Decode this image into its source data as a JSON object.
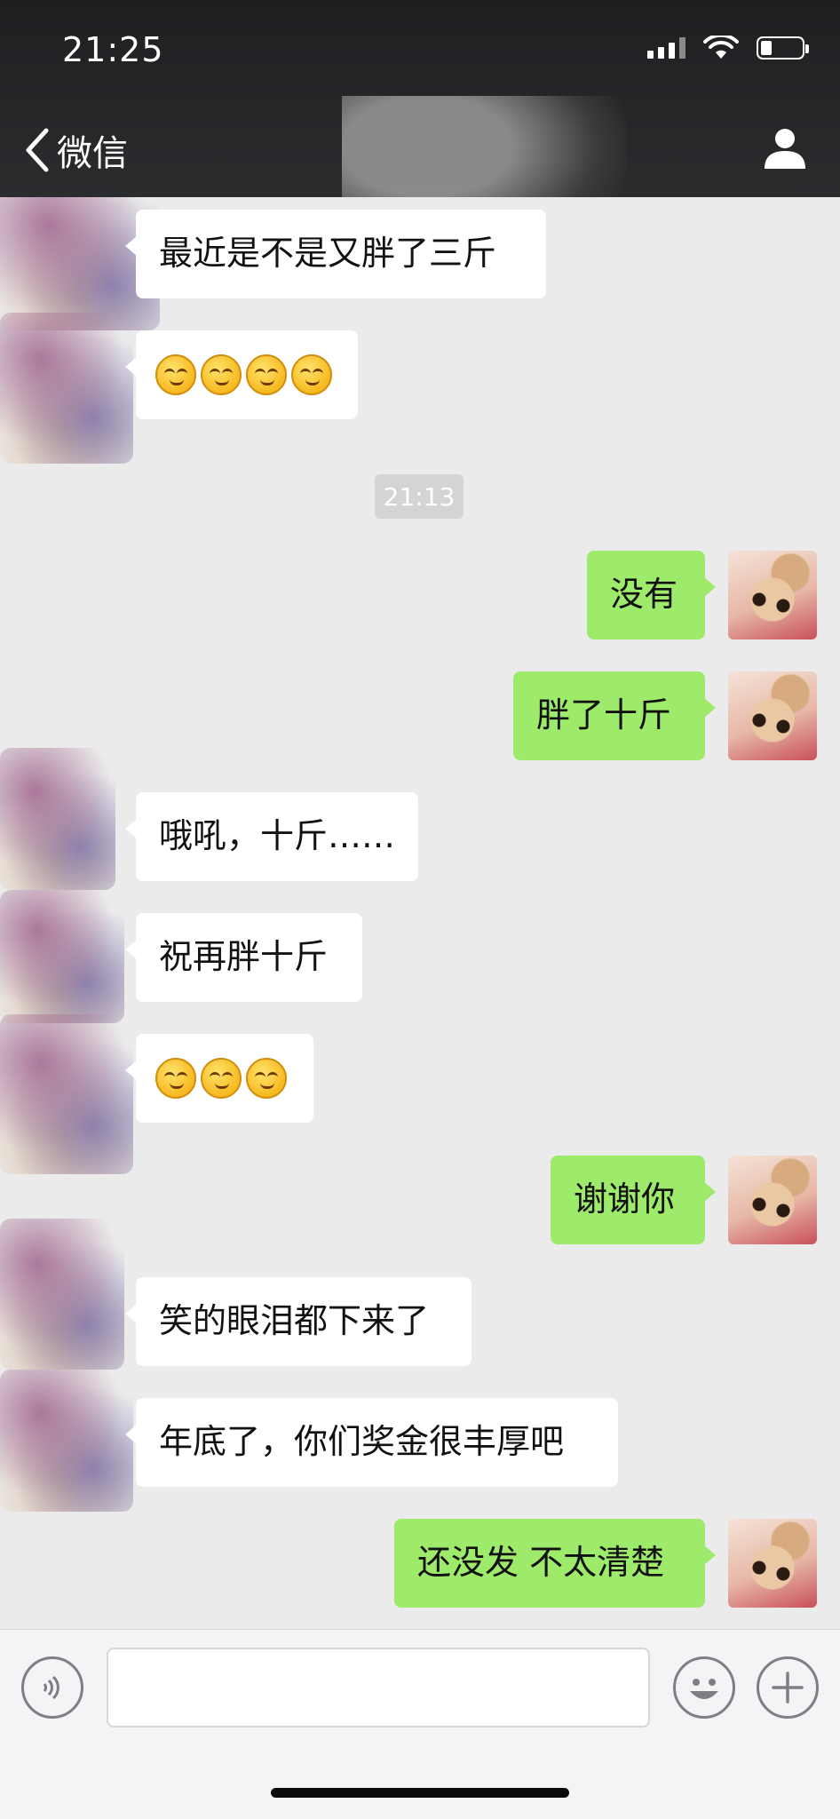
{
  "status_bar": {
    "time": "21:25"
  },
  "nav": {
    "back_label": "微信"
  },
  "chat": {
    "timestamp": "21:13",
    "messages": [
      {
        "side": "in",
        "text": "最近是不是又胖了三斤"
      },
      {
        "side": "in",
        "emoji": [
          "smirk-emoji",
          "smirk-emoji",
          "smirk-emoji",
          "smirk-emoji"
        ]
      },
      {
        "side": "out",
        "text": "没有"
      },
      {
        "side": "out",
        "text": "胖了十斤"
      },
      {
        "side": "in",
        "text": "哦吼，十斤……"
      },
      {
        "side": "in",
        "text": "祝再胖十斤"
      },
      {
        "side": "in",
        "emoji": [
          "grin-emoji",
          "grin-emoji",
          "grin-emoji"
        ]
      },
      {
        "side": "out",
        "text": "谢谢你"
      },
      {
        "side": "in",
        "text": "笑的眼泪都下来了"
      },
      {
        "side": "in",
        "text": "年底了，你们奖金很丰厚吧"
      },
      {
        "side": "out",
        "text": "还没发 不太清楚"
      }
    ]
  },
  "colors": {
    "incoming_bubble": "#ffffff",
    "outgoing_bubble": "#9eea6a",
    "chat_background": "#ebebeb"
  },
  "icons": [
    "chevron-left-icon",
    "person-icon",
    "voice-icon",
    "emoji-icon",
    "add-icon"
  ]
}
